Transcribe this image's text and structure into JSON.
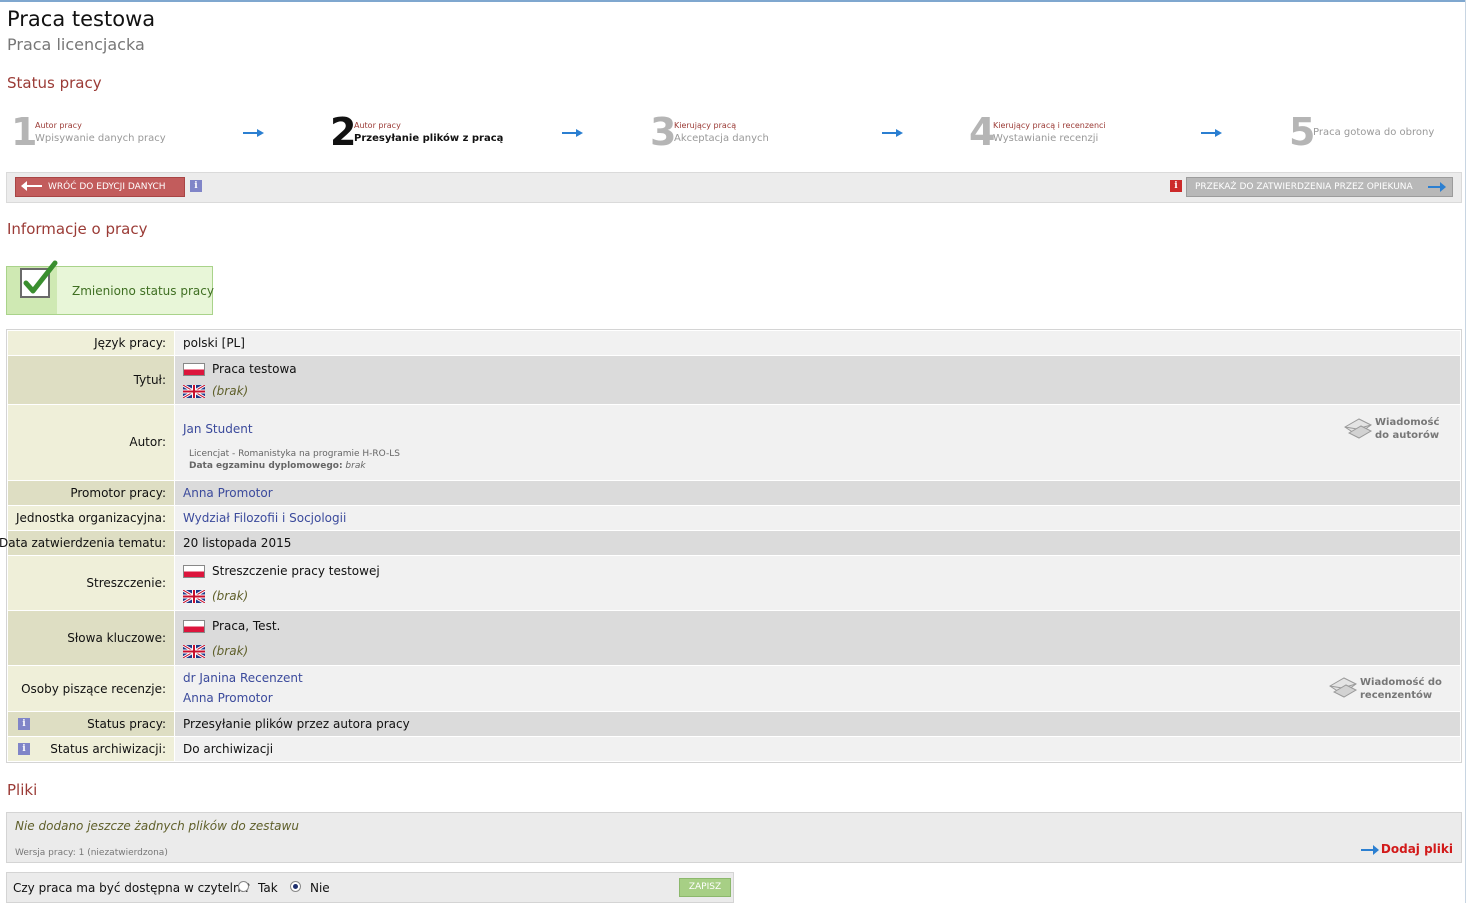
{
  "header": {
    "title": "Praca testowa",
    "subtitle": "Praca licencjacka"
  },
  "sections": {
    "status": "Status pracy",
    "info": "Informacje o pracy",
    "files": "Pliki"
  },
  "steps": [
    {
      "number": "1",
      "small": "Autor pracy",
      "desc": "Wpisywanie danych pracy",
      "active": false
    },
    {
      "number": "2",
      "small": "Autor pracy",
      "desc": "Przesyłanie plików z pracą",
      "active": true
    },
    {
      "number": "3",
      "small": "Kierujący pracą",
      "desc": "Akceptacja danych",
      "active": false
    },
    {
      "number": "4",
      "small": "Kierujący pracą i recenzenci",
      "desc": "Wystawianie recenzji",
      "active": false
    },
    {
      "number": "5",
      "small": "",
      "desc": "Praca gotowa do obrony",
      "active": false
    }
  ],
  "actions": {
    "back_label": "WRÓĆ DO EDYCJI DANYCH",
    "forward_label": "PRZEKAŻ DO ZATWIERDZENIA PRZEZ OPIEKUNA"
  },
  "message": {
    "text": "Zmieniono status pracy"
  },
  "info_table": {
    "language": {
      "label": "Język pracy:",
      "value": "polski [PL]"
    },
    "title": {
      "label": "Tytuł:",
      "pl": "Praca testowa",
      "en": "(brak)"
    },
    "author": {
      "label": "Autor:",
      "name": "Jan Student",
      "program": "Licencjat - Romanistyka na programie H-RO-LS",
      "exam_label": "Data egzaminu dyplomowego:",
      "exam_value": "brak",
      "message_btn_line1": "Wiadomość",
      "message_btn_line2": "do autorów"
    },
    "supervisor": {
      "label": "Promotor pracy:",
      "value": "Anna Promotor"
    },
    "unit": {
      "label": "Jednostka organizacyjna:",
      "value": "Wydział Filozofii i Socjologii"
    },
    "topic_date": {
      "label": "Data zatwierdzenia tematu:",
      "value": "20 listopada 2015"
    },
    "abstract": {
      "label": "Streszczenie:",
      "pl": "Streszczenie pracy testowej",
      "en": "(brak)"
    },
    "keywords": {
      "label": "Słowa kluczowe:",
      "pl": "Praca, Test.",
      "en": "(brak)"
    },
    "reviewers": {
      "label": "Osoby piszące recenzje:",
      "names": [
        "dr Janina Recenzent",
        "Anna Promotor"
      ],
      "message_btn_line1": "Wiadomość do",
      "message_btn_line2": "recenzentów"
    },
    "status": {
      "label": "Status pracy:",
      "value": "Przesyłanie plików przez autora pracy"
    },
    "archive": {
      "label": "Status archiwizacji:",
      "value": "Do archiwizacji"
    }
  },
  "files": {
    "empty_text": "Nie dodano jeszcze żadnych plików do zestawu",
    "version_text": "Wersja pracy: 1 (niezatwierdzona)",
    "add_label": "Dodaj pliki"
  },
  "reading_room": {
    "question": "Czy praca ma być dostępna w czytelni?",
    "yes_label": "Tak",
    "no_label": "Nie",
    "selected": "Nie",
    "save_label": "ZAPISZ"
  },
  "colors": {
    "heading": "#9b3b36",
    "link": "#3b4a9c",
    "accent_blue": "#2b7fd1",
    "back_button": "#c25c5c",
    "success_bg": "#e8f6d8"
  },
  "icons": [
    "info-icon",
    "arrow-left-icon",
    "arrow-right-icon",
    "checkmark-icon",
    "envelope-icon",
    "flag-pl-icon",
    "flag-gb-icon"
  ]
}
